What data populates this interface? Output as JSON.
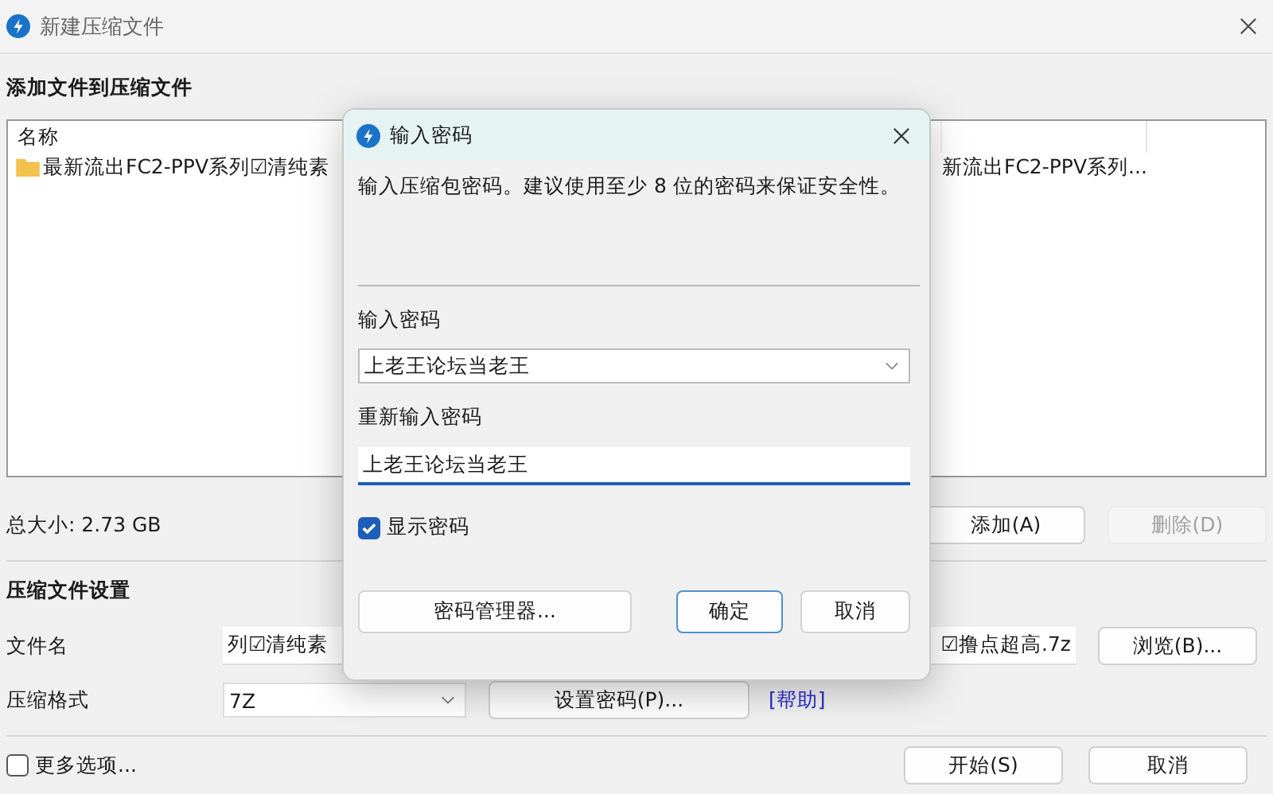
{
  "window": {
    "title": "新建压缩文件"
  },
  "add_section": {
    "heading": "添加文件到压缩文件",
    "file_list": {
      "columns": [
        "名称"
      ],
      "rows": [
        {
          "name": "最新流出FC2-PPV系列☑清纯素",
          "column_2": "新流出FC2-PPV系列..."
        }
      ]
    },
    "total_size": "总大小: 2.73 GB",
    "buttons": [
      {
        "label": "添加(A)",
        "disabled": false
      },
      {
        "label": "删除(D)",
        "disabled": true
      }
    ]
  },
  "settings": {
    "heading": "压缩文件设置",
    "filename": {
      "label": "文件名",
      "value_left": "列☑清纯素",
      "value_right": "☑撸点超高.7z"
    },
    "browse_button": "浏览(B)...",
    "format": {
      "label": "压缩格式",
      "value": "7Z"
    },
    "set_password_button": "设置密码(P)...",
    "help_link": "[帮助]"
  },
  "footer": {
    "more_options": {
      "label": "更多选项...",
      "checked": false
    },
    "buttons": [
      "开始(S)",
      "取消"
    ]
  },
  "password_dialog": {
    "title": "输入密码",
    "message": "输入压缩包密码。建议使用至少 8 位的密码来保证安全性。",
    "password": {
      "label": "输入密码",
      "value": "上老王论坛当老王"
    },
    "confirm": {
      "label": "重新输入密码",
      "value": "上老王论坛当老王"
    },
    "show_password": {
      "label": "显示密码",
      "checked": true
    },
    "buttons": [
      {
        "label": "密码管理器...",
        "kind": "plain"
      },
      {
        "label": "确定",
        "kind": "default"
      },
      {
        "label": "取消",
        "kind": "plain"
      }
    ]
  }
}
